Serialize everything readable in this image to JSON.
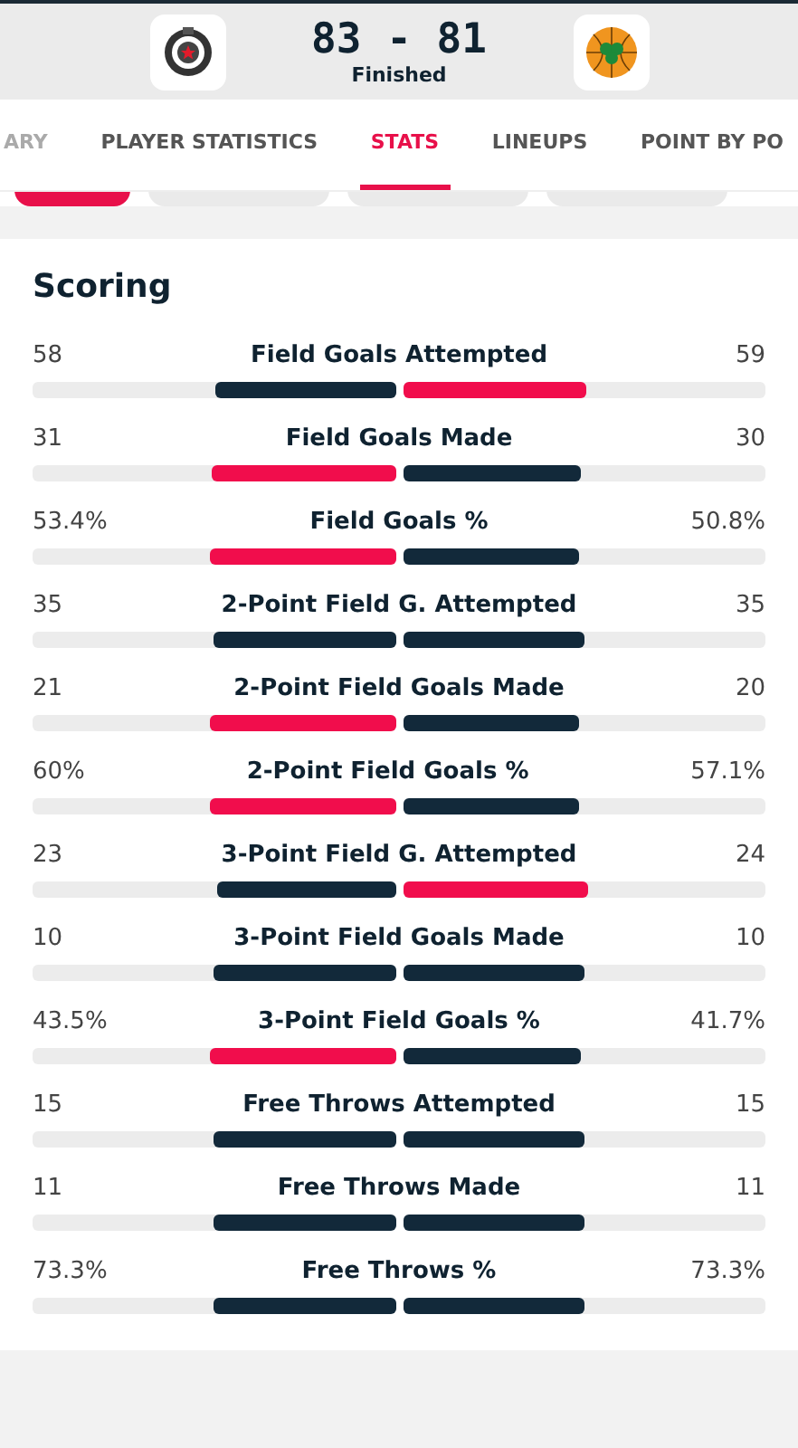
{
  "header": {
    "score": "83 - 81",
    "status": "Finished"
  },
  "tabs": [
    {
      "label": "ARY",
      "selected": false
    },
    {
      "label": "PLAYER STATISTICS",
      "selected": false
    },
    {
      "label": "STATS",
      "selected": true
    },
    {
      "label": "LINEUPS",
      "selected": false
    },
    {
      "label": "POINT BY PO",
      "selected": false
    }
  ],
  "filter_pills": [
    {
      "selected": true
    },
    {
      "selected": false
    },
    {
      "selected": false
    },
    {
      "selected": false
    }
  ],
  "section": {
    "title": "Scoring",
    "rows": [
      {
        "label": "Field Goals Attempted",
        "home": {
          "value": "58",
          "level": 0.496,
          "leading": false
        },
        "away": {
          "value": "59",
          "level": 0.504,
          "leading": true
        }
      },
      {
        "label": "Field Goals Made",
        "home": {
          "value": "31",
          "level": 0.508,
          "leading": true
        },
        "away": {
          "value": "30",
          "level": 0.492,
          "leading": false
        }
      },
      {
        "label": "Field Goals %",
        "home": {
          "value": "53.4%",
          "level": 0.512,
          "leading": true
        },
        "away": {
          "value": "50.8%",
          "level": 0.488,
          "leading": false
        }
      },
      {
        "label": "2-Point Field G. Attempted",
        "home": {
          "value": "35",
          "level": 0.5,
          "leading": false
        },
        "away": {
          "value": "35",
          "level": 0.5,
          "leading": false
        }
      },
      {
        "label": "2-Point Field Goals Made",
        "home": {
          "value": "21",
          "level": 0.512,
          "leading": true
        },
        "away": {
          "value": "20",
          "level": 0.488,
          "leading": false
        }
      },
      {
        "label": "2-Point Field Goals %",
        "home": {
          "value": "60%",
          "level": 0.512,
          "leading": true
        },
        "away": {
          "value": "57.1%",
          "level": 0.488,
          "leading": false
        }
      },
      {
        "label": "3-Point Field G. Attempted",
        "home": {
          "value": "23",
          "level": 0.489,
          "leading": false
        },
        "away": {
          "value": "24",
          "level": 0.511,
          "leading": true
        }
      },
      {
        "label": "3-Point Field Goals Made",
        "home": {
          "value": "10",
          "level": 0.5,
          "leading": false
        },
        "away": {
          "value": "10",
          "level": 0.5,
          "leading": false
        }
      },
      {
        "label": "3-Point Field Goals %",
        "home": {
          "value": "43.5%",
          "level": 0.51,
          "leading": true
        },
        "away": {
          "value": "41.7%",
          "level": 0.49,
          "leading": false
        }
      },
      {
        "label": "Free Throws Attempted",
        "home": {
          "value": "15",
          "level": 0.5,
          "leading": false
        },
        "away": {
          "value": "15",
          "level": 0.5,
          "leading": false
        }
      },
      {
        "label": "Free Throws Made",
        "home": {
          "value": "11",
          "level": 0.5,
          "leading": false
        },
        "away": {
          "value": "11",
          "level": 0.5,
          "leading": false
        }
      },
      {
        "label": "Free Throws %",
        "home": {
          "value": "73.3%",
          "level": 0.5,
          "leading": false
        },
        "away": {
          "value": "73.3%",
          "level": 0.5,
          "leading": false
        }
      }
    ]
  }
}
